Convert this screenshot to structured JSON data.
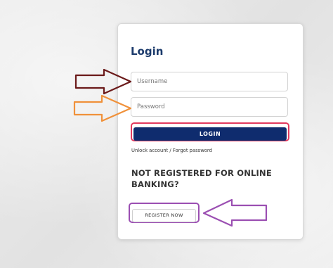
{
  "login": {
    "title": "Login",
    "username_placeholder": "Username",
    "password_placeholder": "Password",
    "login_button": "LOGIN",
    "help_link": "Unlock account / Forgot password"
  },
  "register": {
    "heading": "NOT REGISTERED FOR ONLINE BANKING?",
    "button": "REGISTER NOW"
  },
  "annotations": {
    "username_arrow_color": "#6b1a1a",
    "password_arrow_color": "#f0913a",
    "login_highlight_color": "#e23a5e",
    "register_highlight_color": "#9b4fb2",
    "register_arrow_color": "#9b4fb2"
  },
  "colors": {
    "brand_navy": "#0f2c6e",
    "title_blue": "#1b3a6b"
  }
}
